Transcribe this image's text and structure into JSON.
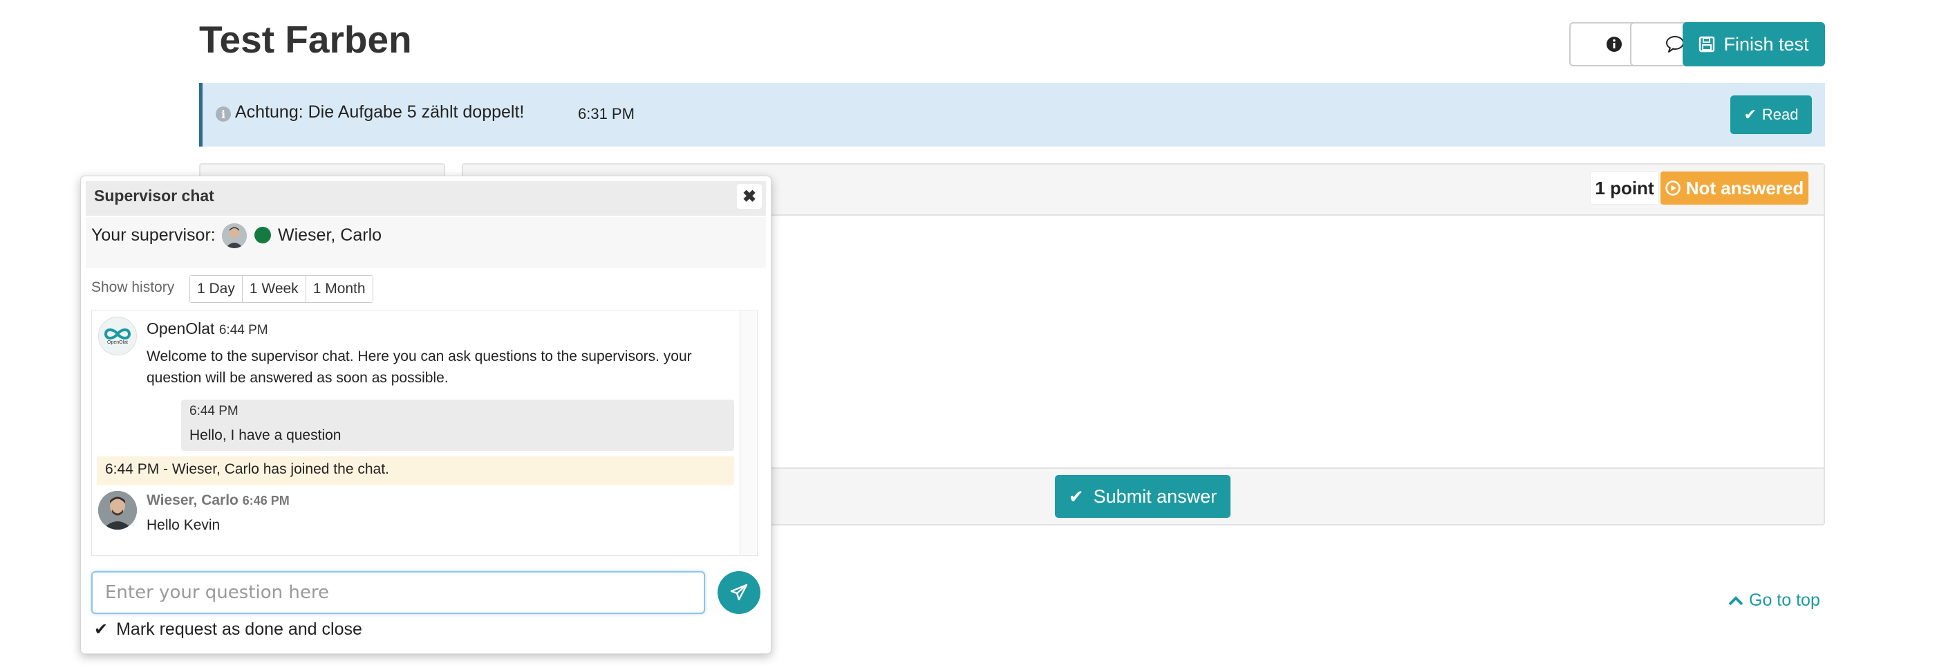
{
  "page": {
    "title": "Test Farben"
  },
  "toolbar": {
    "finish_label": "Finish test"
  },
  "notice": {
    "text": "Achtung: Die Aufgabe 5 zählt doppelt!",
    "time": "6:31 PM",
    "read_label": "Read"
  },
  "question": {
    "points": "1 point",
    "status": "Not answered",
    "submit_label": "Submit answer"
  },
  "footer": {
    "go_to_top": "Go to top"
  },
  "chat": {
    "title": "Supervisor chat",
    "supervisor_label": "Your supervisor:",
    "supervisor_name": "Wieser, Carlo",
    "history_label": "Show history",
    "history_options": [
      "1 Day",
      "1 Week",
      "1 Month"
    ],
    "messages": {
      "system": {
        "sender": "OpenOlat",
        "time": "6:44 PM",
        "text": "Welcome to the supervisor chat. Here you can ask questions to the supervisors. your question will be answered as soon as possible.",
        "avatar_label": "OpenOlat"
      },
      "own": {
        "time": "6:44 PM",
        "text": "Hello, I have a question"
      },
      "join": "6:44 PM - Wieser, Carlo has joined the chat.",
      "supervisor": {
        "sender": "Wieser, Carlo",
        "time": "6:46 PM",
        "text": "Hello Kevin"
      }
    },
    "input_placeholder": "Enter your question here",
    "done_label": "Mark request as done and close"
  },
  "colors": {
    "accent": "#1d9aa1",
    "warning": "#f3a83b",
    "info_bg": "#d9eaf6",
    "online": "#147a3f"
  }
}
